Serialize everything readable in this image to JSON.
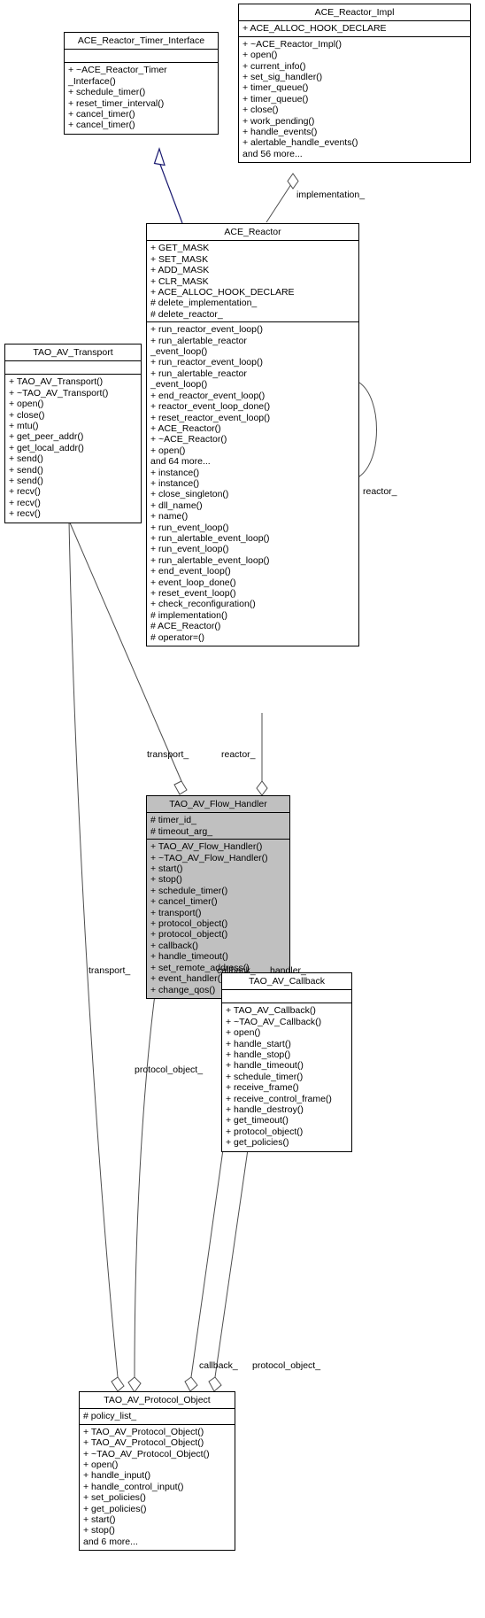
{
  "diagram": {
    "type": "uml-class-diagram",
    "background": "#ffffff",
    "highlight_color": "#c0c0c0",
    "inheritance_edge_color": "#191970",
    "association_edge_color": "#4d4d4d"
  },
  "classes": {
    "ace_reactor_impl": {
      "name": "ACE_Reactor_Impl",
      "attributes": [
        "+ ACE_ALLOC_HOOK_DECLARE"
      ],
      "operations": [
        "+ ~ACE_Reactor_Impl()",
        "+ open()",
        "+ current_info()",
        "+ set_sig_handler()",
        "+ timer_queue()",
        "+ timer_queue()",
        "+ close()",
        "+ work_pending()",
        "+ handle_events()",
        "+ alertable_handle_events()",
        "and 56 more..."
      ]
    },
    "ace_reactor_timer_interface": {
      "name": "ACE_Reactor_Timer_Interface",
      "attributes": [],
      "operations": [
        "+ ~ACE_Reactor_Timer",
        "_Interface()",
        "+ schedule_timer()",
        "+ reset_timer_interval()",
        "+ cancel_timer()",
        "+ cancel_timer()"
      ]
    },
    "ace_reactor": {
      "name": "ACE_Reactor",
      "attributes": [
        "+ GET_MASK",
        "+ SET_MASK",
        "+ ADD_MASK",
        "+ CLR_MASK",
        "+ ACE_ALLOC_HOOK_DECLARE",
        "# delete_implementation_",
        "# delete_reactor_"
      ],
      "operations": [
        "+ run_reactor_event_loop()",
        "+ run_alertable_reactor",
        "_event_loop()",
        "+ run_reactor_event_loop()",
        "+ run_alertable_reactor",
        "_event_loop()",
        "+ end_reactor_event_loop()",
        "+ reactor_event_loop_done()",
        "+ reset_reactor_event_loop()",
        "+ ACE_Reactor()",
        "+ ~ACE_Reactor()",
        "+ open()",
        "and 64 more...",
        "+ instance()",
        "+ instance()",
        "+ close_singleton()",
        "+ dll_name()",
        "+ name()",
        "+ run_event_loop()",
        "+ run_alertable_event_loop()",
        "+ run_event_loop()",
        "+ run_alertable_event_loop()",
        "+ end_event_loop()",
        "+ event_loop_done()",
        "+ reset_event_loop()",
        "+ check_reconfiguration()",
        "# implementation()",
        "# ACE_Reactor()",
        "# operator=()"
      ]
    },
    "tao_av_transport": {
      "name": "TAO_AV_Transport",
      "attributes": [],
      "operations": [
        "+ TAO_AV_Transport()",
        "+ ~TAO_AV_Transport()",
        "+ open()",
        "+ close()",
        "+ mtu()",
        "+ get_peer_addr()",
        "+ get_local_addr()",
        "+ send()",
        "+ send()",
        "+ send()",
        "+ recv()",
        "+ recv()",
        "+ recv()"
      ]
    },
    "tao_av_flow_handler": {
      "name": "TAO_AV_Flow_Handler",
      "highlighted": true,
      "attributes": [
        "# timer_id_",
        "# timeout_arg_"
      ],
      "operations": [
        "+ TAO_AV_Flow_Handler()",
        "+ ~TAO_AV_Flow_Handler()",
        "+ start()",
        "+ stop()",
        "+ schedule_timer()",
        "+ cancel_timer()",
        "+ transport()",
        "+ protocol_object()",
        "+ protocol_object()",
        "+ callback()",
        "+ handle_timeout()",
        "+ set_remote_address()",
        "+ event_handler()",
        "+ change_qos()"
      ]
    },
    "tao_av_callback": {
      "name": "TAO_AV_Callback",
      "attributes": [],
      "operations": [
        "+ TAO_AV_Callback()",
        "+ ~TAO_AV_Callback()",
        "+ open()",
        "+ handle_start()",
        "+ handle_stop()",
        "+ handle_timeout()",
        "+ schedule_timer()",
        "+ receive_frame()",
        "+ receive_control_frame()",
        "+ handle_destroy()",
        "+ get_timeout()",
        "+ protocol_object()",
        "+ get_policies()"
      ]
    },
    "tao_av_protocol_object": {
      "name": "TAO_AV_Protocol_Object",
      "attributes": [
        "# policy_list_"
      ],
      "operations": [
        "+ TAO_AV_Protocol_Object()",
        "+ TAO_AV_Protocol_Object()",
        "+ ~TAO_AV_Protocol_Object()",
        "+ open()",
        "+ handle_input()",
        "+ handle_control_input()",
        "+ set_policies()",
        "+ get_policies()",
        "+ start()",
        "+ stop()",
        "and 6 more..."
      ]
    }
  },
  "edge_labels": {
    "implementation": "implementation_",
    "reactor_right": "reactor_",
    "transport_top": "transport_",
    "reactor_top": "reactor_",
    "transport_bottom": "transport_",
    "callback_upper": "callback_",
    "handler": "handler_",
    "protocol_object_mid": "protocol_object_",
    "callback_lower": "callback_",
    "protocol_object_lower": "protocol_object_"
  }
}
